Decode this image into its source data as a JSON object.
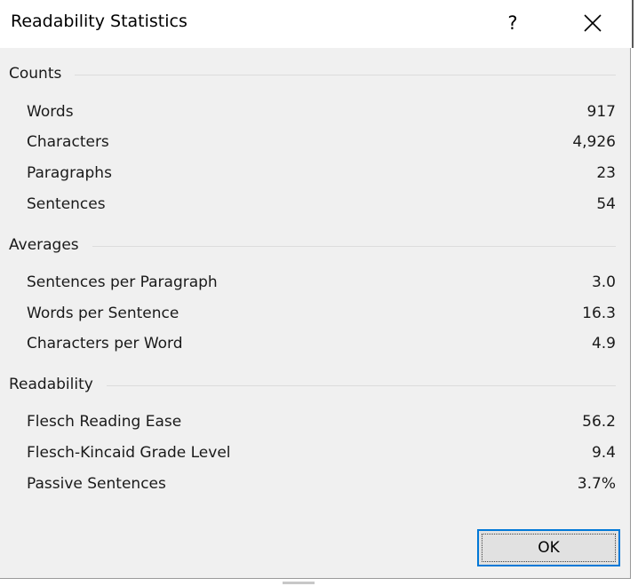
{
  "dialog": {
    "title": "Readability Statistics",
    "help_label": "?",
    "ok_label": "OK"
  },
  "sections": {
    "counts": {
      "header": "Counts",
      "rows": [
        {
          "label": "Words",
          "value": "917"
        },
        {
          "label": "Characters",
          "value": "4,926"
        },
        {
          "label": "Paragraphs",
          "value": "23"
        },
        {
          "label": "Sentences",
          "value": "54"
        }
      ]
    },
    "averages": {
      "header": "Averages",
      "rows": [
        {
          "label": "Sentences per Paragraph",
          "value": "3.0"
        },
        {
          "label": "Words per Sentence",
          "value": "16.3"
        },
        {
          "label": "Characters per Word",
          "value": "4.9"
        }
      ]
    },
    "readability": {
      "header": "Readability",
      "rows": [
        {
          "label": "Flesch Reading Ease",
          "value": "56.2"
        },
        {
          "label": "Flesch-Kincaid Grade Level",
          "value": "9.4"
        },
        {
          "label": "Passive Sentences",
          "value": "3.7%"
        }
      ]
    }
  }
}
